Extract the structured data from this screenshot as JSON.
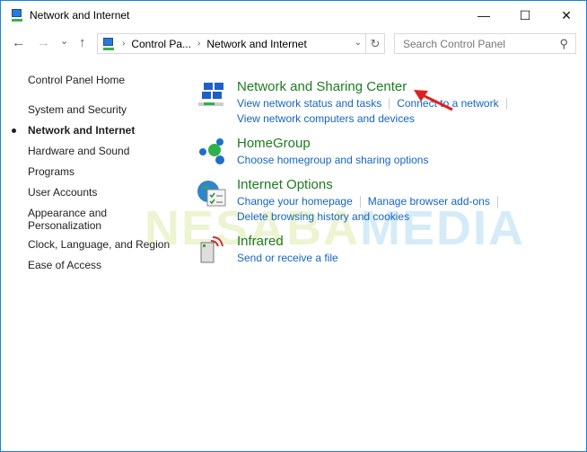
{
  "window": {
    "title": "Network and Internet",
    "minimize": "—",
    "maximize": "☐",
    "close": "✕"
  },
  "nav": {
    "back": "←",
    "forward": "→",
    "recent": "⌄",
    "up": "↑",
    "breadcrumb": [
      "Control Pa...",
      "Network and Internet"
    ],
    "refresh": "↻",
    "search_placeholder": "Search Control Panel",
    "search_icon": "⚲"
  },
  "sidebar": {
    "items": [
      {
        "label": "Control Panel Home"
      },
      {
        "label": "System and Security"
      },
      {
        "label": "Network and Internet",
        "current": true
      },
      {
        "label": "Hardware and Sound"
      },
      {
        "label": "Programs"
      },
      {
        "label": "User Accounts"
      },
      {
        "label": "Appearance and Personalization"
      },
      {
        "label": "Clock, Language, and Region"
      },
      {
        "label": "Ease of Access"
      }
    ]
  },
  "categories": [
    {
      "title": "Network and Sharing Center",
      "icon": "network-sharing-icon",
      "links": [
        "View network status and tasks",
        "Connect to a network",
        "View network computers and devices"
      ]
    },
    {
      "title": "HomeGroup",
      "icon": "homegroup-icon",
      "links": [
        "Choose homegroup and sharing options"
      ]
    },
    {
      "title": "Internet Options",
      "icon": "internet-options-icon",
      "links": [
        "Change your homepage",
        "Manage browser add-ons",
        "Delete browsing history and cookies"
      ]
    },
    {
      "title": "Infrared",
      "icon": "infrared-icon",
      "links": [
        "Send or receive a file"
      ]
    }
  ],
  "watermark": {
    "part1": "NESABA",
    "part2": "MEDIA"
  },
  "colors": {
    "heading": "#1d7b20",
    "link": "#1565c0",
    "annotation_arrow": "#e02020"
  }
}
